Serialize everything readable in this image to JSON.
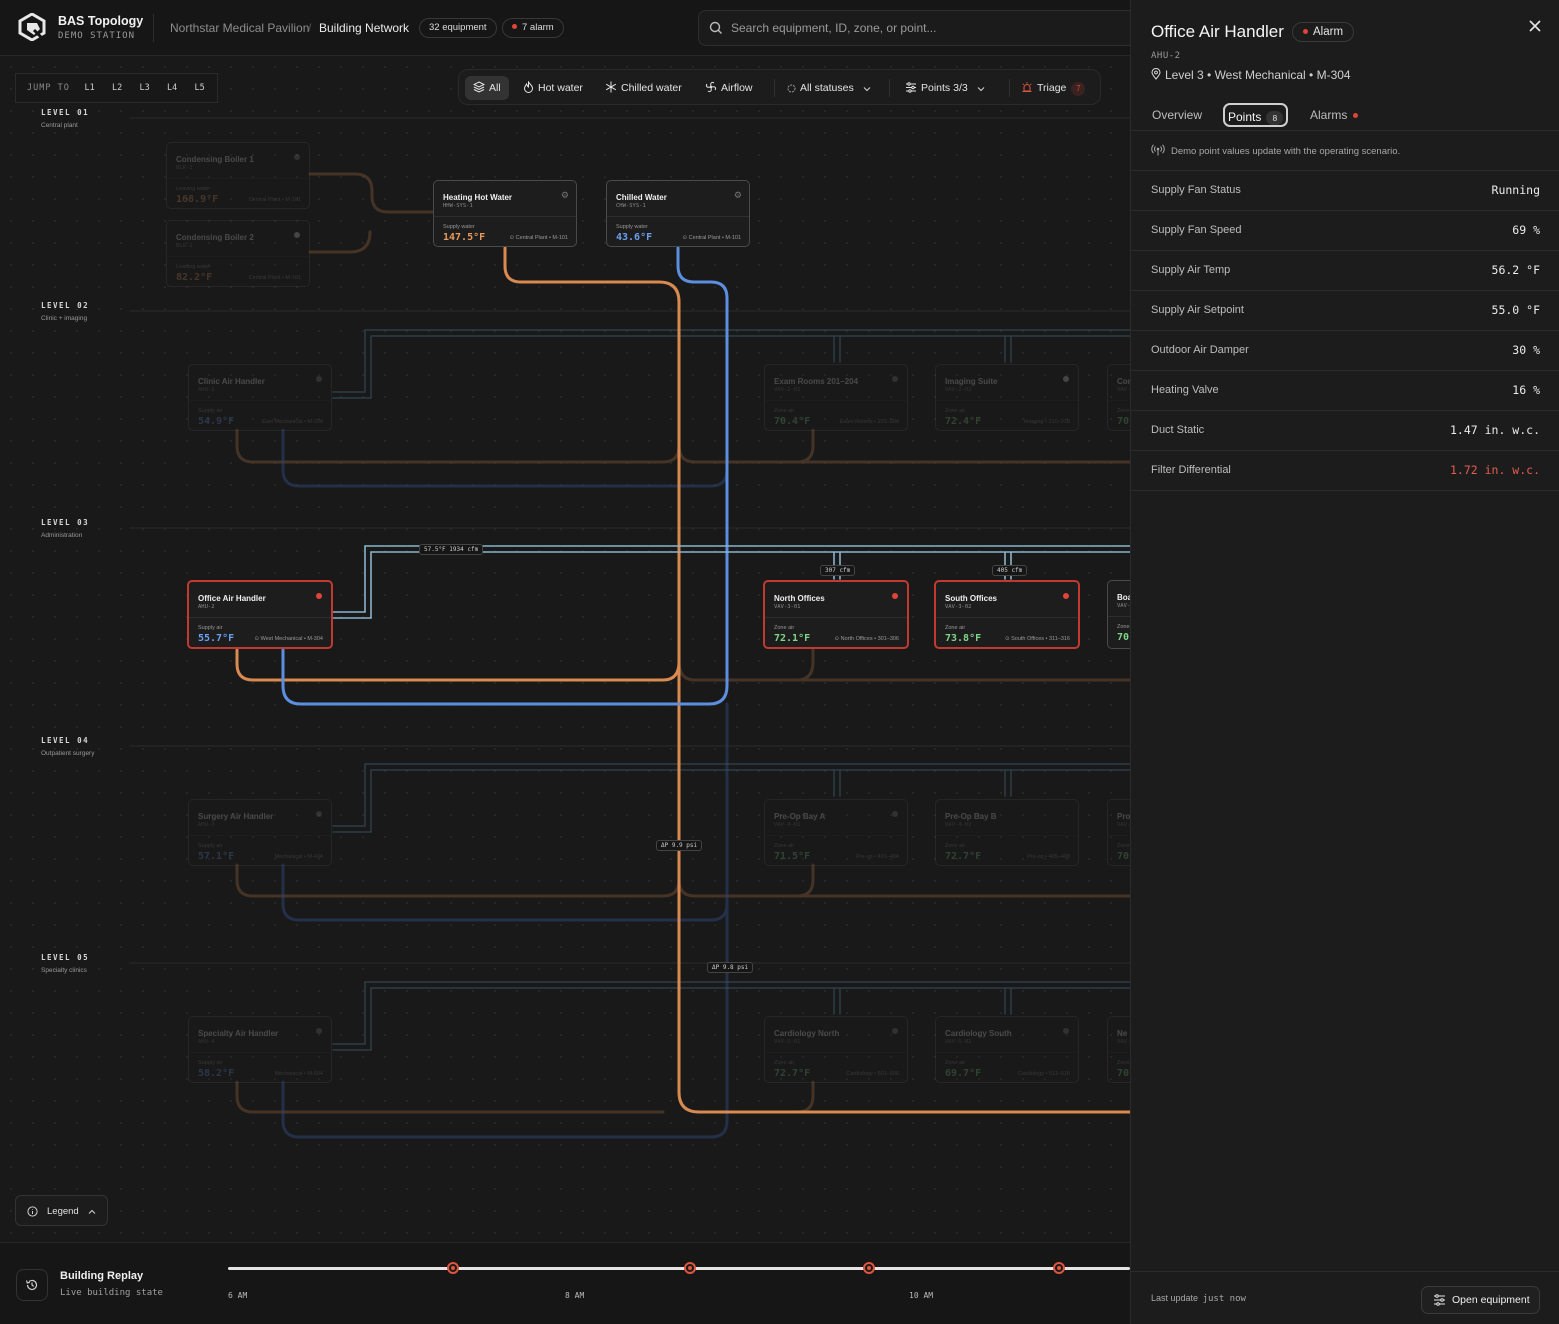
{
  "header": {
    "app_title": "BAS Topology",
    "app_subtitle": "DEMO STATION",
    "breadcrumb_site": "Northstar Medical Pavilion",
    "breadcrumb_sep": "/",
    "breadcrumb_page": "Building Network",
    "equipment_count": "32 equipment",
    "alarm_count": "7 alarm",
    "search_placeholder": "Search equipment, ID, zone, or point..."
  },
  "jump": {
    "label": "JUMP TO",
    "levels": [
      "L1",
      "L2",
      "L3",
      "L4",
      "L5"
    ]
  },
  "toolbar": {
    "all": "All",
    "hot_water": "Hot water",
    "chilled_water": "Chilled water",
    "airflow": "Airflow",
    "statuses": "All statuses",
    "points": "Points 3/3",
    "triage": "Triage",
    "triage_count": "7"
  },
  "levels": [
    {
      "title": "LEVEL 01",
      "subtitle": "Central plant"
    },
    {
      "title": "LEVEL 02",
      "subtitle": "Clinic + imaging"
    },
    {
      "title": "LEVEL 03",
      "subtitle": "Administration"
    },
    {
      "title": "LEVEL 04",
      "subtitle": "Outpatient surgery"
    },
    {
      "title": "LEVEL 05",
      "subtitle": "Specialty clinics"
    }
  ],
  "cards": {
    "boiler1": {
      "name": "Condensing Boiler 1",
      "id": "BLR-1",
      "label": "Leaving water",
      "value": "168.9°F",
      "loc": "Central Plant • M-101"
    },
    "boiler2": {
      "name": "Condensing Boiler 2",
      "id": "BLR-2",
      "label": "Leaving water",
      "value": "82.2°F",
      "loc": "Central Plant • M-101"
    },
    "hhw": {
      "name": "Heating Hot Water",
      "id": "HHW-SYS-1",
      "label": "Supply water",
      "value": "147.5°F",
      "loc": "Central Plant • M-101"
    },
    "chw": {
      "name": "Chilled Water",
      "id": "CHW-SYS-1",
      "label": "Supply water",
      "value": "43.6°F",
      "loc": "Central Plant • M-101"
    },
    "clinic_ahu": {
      "name": "Clinic Air Handler",
      "id": "AHU-1",
      "label": "Supply air",
      "value": "54.9°F",
      "loc": "East Mechanical • M-204"
    },
    "exam": {
      "name": "Exam Rooms 201–204",
      "id": "VAV-2-01",
      "label": "Zone air",
      "value": "70.4°F",
      "loc": "Exam Rooms • 201–204"
    },
    "imaging": {
      "name": "Imaging Suite",
      "id": "VAV-2-02",
      "label": "Zone air",
      "value": "72.4°F",
      "loc": "Imaging • 210–218"
    },
    "l2_extra": {
      "name": "Con",
      "id": "VAV-2-03",
      "label": "Zone air",
      "value": "70",
      "loc": ""
    },
    "office_ahu": {
      "name": "Office Air Handler",
      "id": "AHU-2",
      "label": "Supply air",
      "value": "55.7°F",
      "loc": "West Mechanical • M-304"
    },
    "north": {
      "name": "North Offices",
      "id": "VAV-3-01",
      "label": "Zone air",
      "value": "72.1°F",
      "loc": "North Offices • 301–306"
    },
    "south": {
      "name": "South Offices",
      "id": "VAV-3-02",
      "label": "Zone air",
      "value": "73.8°F",
      "loc": "South Offices • 311–316"
    },
    "board": {
      "name": "Boa",
      "id": "VAV-",
      "label": "Zone",
      "value": "70.",
      "loc": ""
    },
    "surgery_ahu": {
      "name": "Surgery Air Handler",
      "id": "AHU-3",
      "label": "Supply air",
      "value": "57.1°F",
      "loc": "Mechanical • M-404"
    },
    "preop_a": {
      "name": "Pre-Op Bay A",
      "id": "VAV-4-01",
      "label": "Zone air",
      "value": "71.5°F",
      "loc": "Pre-op • 401–404"
    },
    "preop_b": {
      "name": "Pre-Op Bay B",
      "id": "VAV-4-02",
      "label": "Zone air",
      "value": "72.7°F",
      "loc": "Pre-op • 405–408"
    },
    "l4_extra": {
      "name": "Pro",
      "id": "VAV-4-03",
      "label": "Zone air",
      "value": "70",
      "loc": ""
    },
    "specialty_ahu": {
      "name": "Specialty Air Handler",
      "id": "AHU-4",
      "label": "Supply air",
      "value": "58.2°F",
      "loc": "Mechanical • M-504"
    },
    "cardio_n": {
      "name": "Cardiology North",
      "id": "VAV-5-01",
      "label": "Zone air",
      "value": "72.7°F",
      "loc": "Cardiology • 501–506"
    },
    "cardio_s": {
      "name": "Cardiology South",
      "id": "VAV-5-02",
      "label": "Zone air",
      "value": "69.7°F",
      "loc": "Cardiology • 511–516"
    },
    "l5_extra": {
      "name": "Ne",
      "id": "VAV-5-03",
      "label": "Zone air",
      "value": "70",
      "loc": ""
    }
  },
  "tags": {
    "duct": "57.5°F  1934 cfm",
    "north_cfm": "307 cfm",
    "south_cfm": "405 cfm",
    "dp1": "ΔP 9.9 psi",
    "dp2": "ΔP 9.8 psi"
  },
  "legend_label": "Legend",
  "replay": {
    "title": "Building Replay",
    "subtitle": "Live building state",
    "ticks": [
      "6 AM",
      "8 AM",
      "10 AM"
    ],
    "alarm_markers_at": [
      "6:50 AM",
      "8:44 AM",
      "9:48 AM",
      "10:55 AM"
    ]
  },
  "panel": {
    "title": "Office Air Handler",
    "status": "Alarm",
    "equipment_id": "AHU-2",
    "location": "Level 3 • West Mechanical • M-304",
    "tabs": {
      "overview": "Overview",
      "points": "Points",
      "points_count": "8",
      "alarms": "Alarms"
    },
    "note": "Demo point values update with the operating scenario.",
    "points": [
      {
        "name": "Supply Fan Status",
        "value": "Running",
        "alarm": false
      },
      {
        "name": "Supply Fan Speed",
        "value": "69 %",
        "alarm": false
      },
      {
        "name": "Supply Air Temp",
        "value": "56.2 °F",
        "alarm": false
      },
      {
        "name": "Supply Air Setpoint",
        "value": "55.0 °F",
        "alarm": false
      },
      {
        "name": "Outdoor Air Damper",
        "value": "30 %",
        "alarm": false
      },
      {
        "name": "Heating Valve",
        "value": "16 %",
        "alarm": false
      },
      {
        "name": "Duct Static",
        "value": "1.47 in. w.c.",
        "alarm": false
      },
      {
        "name": "Filter Differential",
        "value": "1.72 in. w.c.",
        "alarm": true
      }
    ],
    "last_update_label": "Last update",
    "last_update_value": "just now",
    "open_button": "Open equipment"
  },
  "colors": {
    "hot": "#d98a50",
    "chilled": "#5d8fe0",
    "air": "#8ab4cc",
    "alarm": "#c13a31",
    "hot_value": "#e89a5a",
    "chilled_value": "#6aa0f0",
    "zone_value": "#7fd68a"
  }
}
